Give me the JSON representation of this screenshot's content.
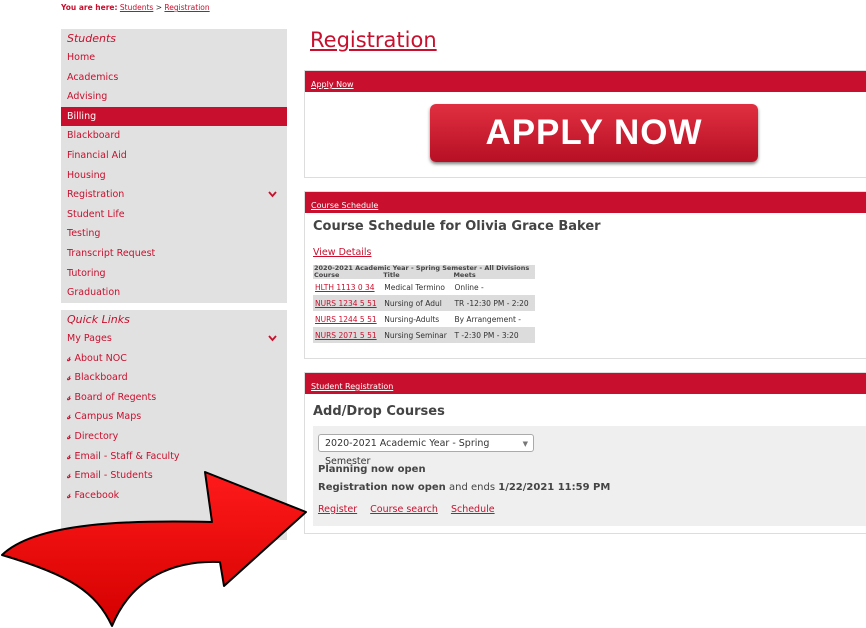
{
  "breadcrumb": {
    "prefix": "You are here:",
    "items": [
      "Students",
      "Registration"
    ],
    "separator": ">"
  },
  "sidebar": {
    "students_title": "Students",
    "students_items": [
      {
        "label": "Home"
      },
      {
        "label": "Academics"
      },
      {
        "label": "Advising"
      },
      {
        "label": "Billing",
        "active": true
      },
      {
        "label": "Blackboard"
      },
      {
        "label": "Financial Aid"
      },
      {
        "label": "Housing"
      },
      {
        "label": "Registration",
        "expand": true
      },
      {
        "label": "Student Life"
      },
      {
        "label": "Testing"
      },
      {
        "label": "Transcript Request"
      },
      {
        "label": "Tutoring"
      },
      {
        "label": "Graduation"
      }
    ],
    "quick_title": "Quick Links",
    "my_pages": "My Pages",
    "quick_items": [
      "About NOC",
      "Blackboard",
      "Board of Regents",
      "Campus Maps",
      "Directory",
      "Email - Staff & Faculty",
      "Email - Students",
      "Facebook"
    ]
  },
  "main": {
    "title": "Registration",
    "apply_panel": {
      "header": "Apply Now",
      "button": "APPLY NOW"
    },
    "schedule_panel": {
      "header": "Course Schedule",
      "title": "Course Schedule for Olivia Grace Baker",
      "view_details": "View Details",
      "term_header": "2020-2021 Academic Year - Spring Semester - All Divisions",
      "columns": [
        "Course",
        "Title",
        "Meets"
      ],
      "rows": [
        [
          "HLTH 1113 0 34",
          "Medical Termino",
          "Online -"
        ],
        [
          "NURS 1234 5 51",
          "Nursing of Adul",
          "TR -12:30 PM - 2:20"
        ],
        [
          "NURS 1244 5 51",
          "Nursing-Adults",
          "By Arrangement -"
        ],
        [
          "NURS 2071 5 51",
          "Nursing Seminar",
          "T -2:30 PM - 3:20"
        ]
      ]
    },
    "registration_panel": {
      "header": "Student Registration",
      "title": "Add/Drop Courses",
      "term_select": "2020-2021 Academic Year - Spring Semester",
      "planning": "Planning now open",
      "reg_open_bold": "Registration now open",
      "reg_open_mid": "and ends",
      "reg_deadline": "1/22/2021 11:59 PM",
      "links": [
        "Register",
        "Course search",
        "Schedule"
      ]
    }
  },
  "colors": {
    "accent": "#c8102e",
    "sidebar_bg": "#e1e1e1"
  },
  "icons": {
    "expand": "chevron-down-icon",
    "quick_link": "link-icon",
    "overlay": "red-curved-arrow"
  }
}
